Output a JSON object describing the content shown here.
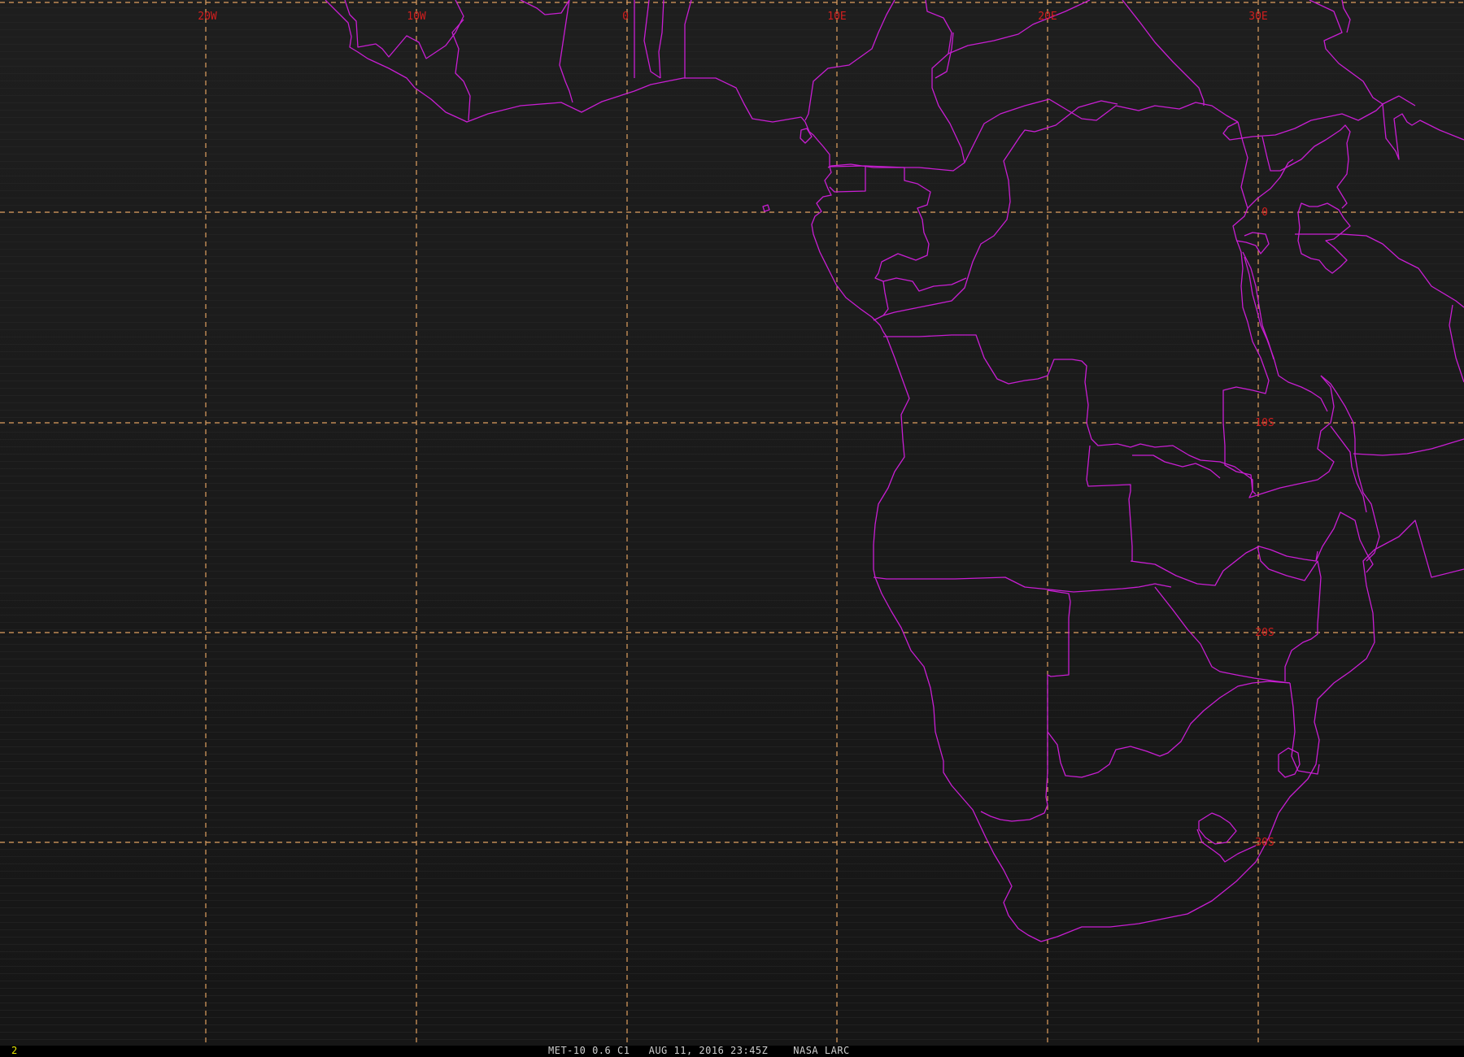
{
  "map": {
    "background_color": "#1b1b1b",
    "grid_color": "#e0a060",
    "boundary_color": "#c81ed2",
    "label_color": "#d21e1e",
    "longitude_labels": [
      "20W",
      "10W",
      "0",
      "10E",
      "20E",
      "30E"
    ],
    "latitude_labels": [
      "0",
      "10S",
      "20S",
      "30S"
    ]
  },
  "footer": {
    "frame_number": "2",
    "caption": "MET-10 0.6 C1   AUG 11, 2016 23:45Z    NASA LARC"
  }
}
